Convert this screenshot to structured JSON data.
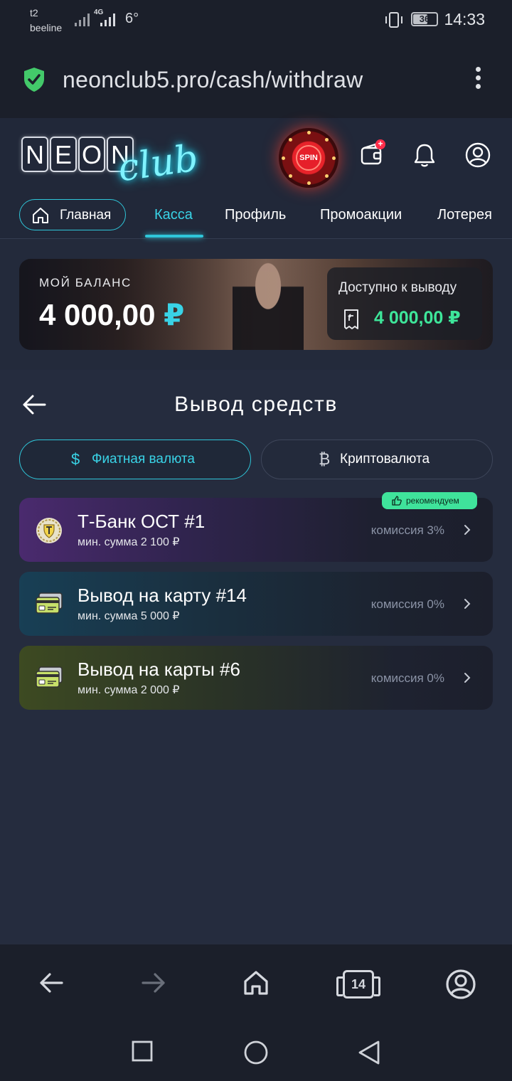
{
  "status": {
    "carrier_top": "t2",
    "carrier_bottom": "beeline",
    "net": "4G",
    "temperature": "6°",
    "battery": "36",
    "time": "14:33"
  },
  "browser": {
    "url": "neonclub5.pro/cash/withdraw",
    "tab_count": "14"
  },
  "header": {
    "logo_letters": [
      "N",
      "E",
      "O",
      "N"
    ],
    "logo_script": "club",
    "spin_label": "SPIN",
    "wallet_badge": "+"
  },
  "nav": {
    "items": [
      {
        "label": "Главная"
      },
      {
        "label": "Касса"
      },
      {
        "label": "Профиль"
      },
      {
        "label": "Промоакции"
      },
      {
        "label": "Лотерея"
      }
    ],
    "active": "Касса"
  },
  "balance": {
    "label": "МОЙ БАЛАНС",
    "amount": "4 000,00",
    "currency": "₽",
    "available_label": "Доступно к выводу",
    "available_amount": "4 000,00 ₽"
  },
  "withdraw": {
    "title": "Вывод средств",
    "tabs": [
      {
        "icon": "$",
        "label": "Фиатная валюта",
        "active": true
      },
      {
        "icon": "₿",
        "label": "Криптовалюта",
        "active": false
      }
    ],
    "methods": [
      {
        "name": "Т-Банк ОСТ #1",
        "min": "мин. сумма 2 100 ₽",
        "fee": "комиссия 3%",
        "badge": "рекомендуем",
        "icon": "tbank-logo-icon"
      },
      {
        "name": "Вывод на карту #14",
        "min": "мин. сумма 5 000 ₽",
        "fee": "комиссия 0%",
        "icon": "card-icon"
      },
      {
        "name": "Вывод на карты #6",
        "min": "мин. сумма 2 000 ₽",
        "fee": "комиссия 0%",
        "icon": "card-icon"
      }
    ]
  },
  "colors": {
    "accent": "#2fc6d9",
    "available": "#3ee69a",
    "badge": "#3fe39b"
  }
}
